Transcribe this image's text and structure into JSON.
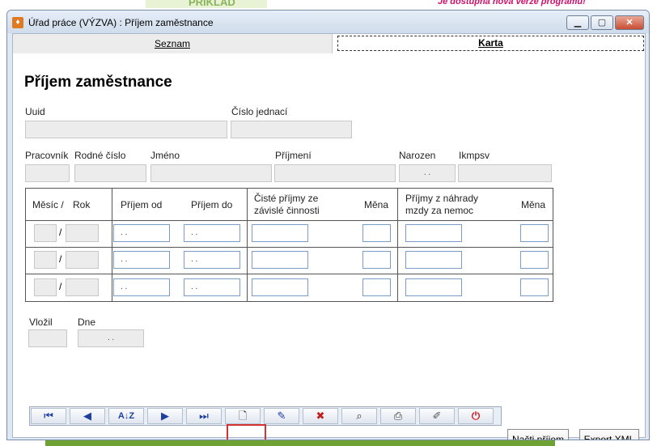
{
  "background": {
    "notice": "Je dostupná nová verze programu!",
    "partial_word": "PŘÍKLAD"
  },
  "window": {
    "title": "Úřad práce (VÝZVA) : Příjem zaměstnance",
    "controls": {
      "minimize": "▁",
      "maximize": "▢",
      "close": "✕"
    }
  },
  "tabs": [
    {
      "label": "Seznam",
      "selected": false
    },
    {
      "label": "Karta",
      "selected": true
    }
  ],
  "form": {
    "title": "Příjem zaměstnance",
    "uuid_label": "Uuid",
    "cislo_jednaci_label": "Číslo jednací",
    "pracovnik_label": "Pracovník",
    "rodne_cislo_label": "Rodné číslo",
    "jmeno_label": "Jméno",
    "prijmeni_label": "Příjmení",
    "narozen_label": "Narozen",
    "narozen_value": ". .",
    "ikmpsv_label": "Ikmpsv",
    "vlozil_label": "Vložil",
    "dne_label": "Dne",
    "dne_value": ". ."
  },
  "grid": {
    "headers": {
      "mesic": "Měsíc /",
      "rok": "Rok",
      "prijem_od": "Příjem od",
      "prijem_do": "Příjem do",
      "ciste_prijmy": "Čisté příjmy ze",
      "ciste_prijmy_2": "závislé činnosti",
      "mena1": "Měna",
      "prijmy_nahrady": "Příjmy z náhrady",
      "prijmy_nahrady_2": "mzdy za nemoc",
      "mena2": "Měna"
    },
    "date_placeholder": ". .",
    "separator": "/"
  },
  "toolbar": {
    "buttons": [
      "first-record",
      "previous-record",
      "sort-az",
      "next-record",
      "last-record",
      "new-record",
      "edit-record",
      "delete-record",
      "search-record",
      "print",
      "clear",
      "exit"
    ]
  },
  "actions": {
    "nacti_prijem": "Načti příjem",
    "export_xml": "Export XML"
  }
}
